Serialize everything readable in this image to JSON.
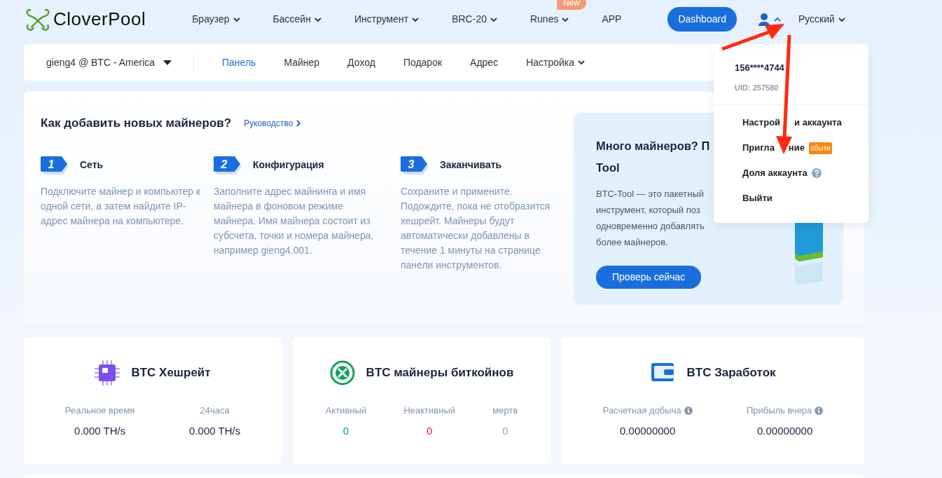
{
  "logo": {
    "text": "CloverPool"
  },
  "top_nav": [
    {
      "label": "Браузер",
      "dropdown": true
    },
    {
      "label": "Бассейн",
      "dropdown": true
    },
    {
      "label": "Инструмент",
      "dropdown": true
    },
    {
      "label": "BRC-20",
      "dropdown": true
    },
    {
      "label": "Runes",
      "dropdown": true,
      "badge": "New"
    },
    {
      "label": "APP",
      "dropdown": false
    }
  ],
  "dashboard_button": "Dashboard",
  "user_menu": {
    "expanded": true
  },
  "language": "Русский",
  "sub_nav": {
    "account": "gieng4 @ BTC - America",
    "tabs": [
      {
        "label": "Панель",
        "selected": true,
        "dropdown": false
      },
      {
        "label": "Майнер",
        "selected": false,
        "dropdown": false
      },
      {
        "label": "Доход",
        "selected": false,
        "dropdown": false
      },
      {
        "label": "Подарок",
        "selected": false,
        "dropdown": false
      },
      {
        "label": "Адрес",
        "selected": false,
        "dropdown": false
      },
      {
        "label": "Настройка",
        "selected": false,
        "dropdown": true
      }
    ]
  },
  "guide": {
    "title": "Как добавить новых майнеров?",
    "link": "Руководство",
    "steps": [
      {
        "number": "1",
        "title": "Сеть",
        "text": "Подключите майнер и компьютер к одной сети, а затем найдите IP-адрес майнера на компьютере."
      },
      {
        "number": "2",
        "title": "Конфигурация",
        "text": "Заполните адрес майнинга и имя майнера в фоновом режиме майнера. Имя майнера состоит из субсчета, точки и номера майнера, например gieng4.001."
      },
      {
        "number": "3",
        "title": "Заканчивать",
        "text": "Сохраните и примените. Подождите, пока не отобразится хешрейт. Майнеры будут автоматически добавлены в течение 1 минуты на странице панели инструментов."
      }
    ]
  },
  "promo": {
    "title_lines": [
      "Много майнеров? П",
      "Tool"
    ],
    "text_lines": [
      "BTC-Tool — это пакетный",
      "инструмент, который поз",
      "одновременно добавлять",
      "более майнеров."
    ],
    "button": "Проверь сейчас"
  },
  "account_menu": {
    "phone": "156****4744",
    "uid": "UID: 257580",
    "items": [
      {
        "parts": [
          "Настрой",
          "и аккаунта"
        ],
        "help": false
      },
      {
        "parts": [
          "Пригла",
          "ние"
        ],
        "badge": "обыти",
        "help": false
      },
      {
        "parts": [
          "Доля аккаунта"
        ],
        "help": true
      },
      {
        "parts": [
          "Выйти"
        ],
        "help": false
      }
    ]
  },
  "stats": [
    {
      "kind": "hashrate",
      "title": "BTC Хешрейт",
      "metrics": [
        {
          "label": "Реальное время",
          "value": "0.000 TH/s",
          "info": false
        },
        {
          "label": "24часа",
          "value": "0.000 TH/s",
          "info": false
        }
      ]
    },
    {
      "kind": "miners",
      "title": "BTC майнеры биткойнов",
      "metrics": [
        {
          "label": "Активный",
          "value": "0",
          "color": "#0aa75a",
          "info": false
        },
        {
          "label": "Неактивный",
          "value": "0",
          "color": "#f5222d",
          "info": false
        },
        {
          "label": "мертв",
          "value": "0",
          "color": "#8fa6c2",
          "info": false
        }
      ]
    },
    {
      "kind": "earnings",
      "title": "BTC Заработок",
      "metrics": [
        {
          "label": "Расчетная добыча",
          "value": "0.00000000",
          "info": true
        },
        {
          "label": "Прибыль вчера",
          "value": "0.00000000",
          "info": true
        }
      ]
    }
  ]
}
